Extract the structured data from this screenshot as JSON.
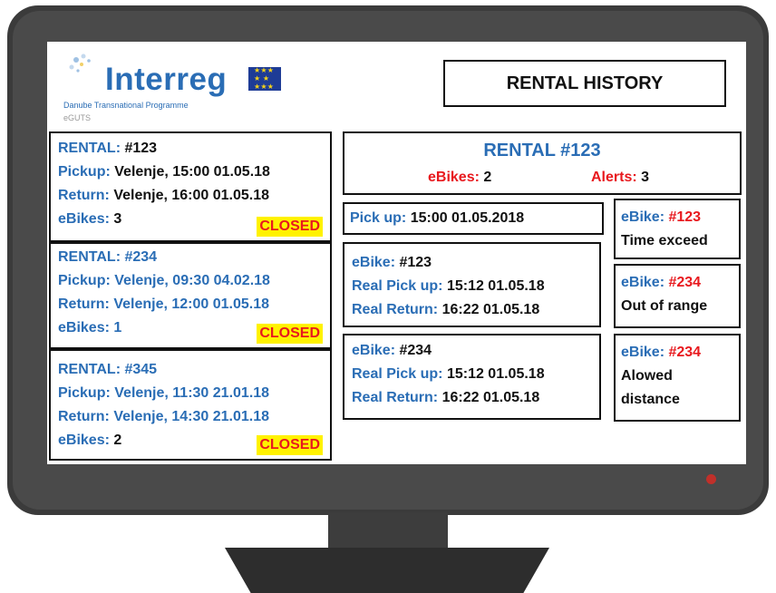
{
  "logo": {
    "brand": "Interreg",
    "program": "Danube Transnational Programme",
    "project": "eGUTS"
  },
  "title": "RENTAL HISTORY",
  "rentals": [
    {
      "rental_label": "RENTAL:",
      "rental_id": "#123",
      "pickup_label": "Pickup:",
      "pickup_value": "Velenje, 15:00  01.05.18",
      "return_label": "Return:",
      "return_value": "Velenje, 16:00  01.05.18",
      "ebikes_label": "eBikes:",
      "ebikes_value": "3",
      "status": "CLOSED"
    },
    {
      "rental_label": "RENTAL:",
      "rental_id": "#234",
      "pickup_label": "Pickup:",
      "pickup_value": "Velenje, 09:30  04.02.18",
      "return_label": "Return:",
      "return_value": "Velenje, 12:00  01.05.18",
      "ebikes_label": "eBikes:",
      "ebikes_value": "1",
      "status": "CLOSED"
    },
    {
      "rental_label": "RENTAL:",
      "rental_id": "#345",
      "pickup_label": "Pickup:",
      "pickup_value": "Velenje, 11:30  21.01.18",
      "return_label": "Return:",
      "return_value": "Velenje, 14:30  21.01.18",
      "ebikes_label": "eBikes:",
      "ebikes_value": "2",
      "status": "CLOSED"
    }
  ],
  "detail": {
    "header": "RENTAL  #123",
    "ebikes_label": "eBikes:",
    "ebikes_value": "2",
    "alerts_label": "Alerts:",
    "alerts_value": "3",
    "pickup_label": "Pick up:",
    "pickup_value": "15:00  01.05.2018",
    "bikes": [
      {
        "label": "eBike:",
        "id": "#123",
        "pickup_label": "Real Pick up:",
        "pickup_value": "15:12  01.05.18",
        "return_label": "Real Return:",
        "return_value": "16:22  01.05.18"
      },
      {
        "label": "eBike:",
        "id": "#234",
        "pickup_label": "Real Pick up:",
        "pickup_value": "15:12  01.05.18",
        "return_label": "Real Return:",
        "return_value": "16:22  01.05.18"
      }
    ],
    "alerts": [
      {
        "label": "eBike:",
        "id": "#123",
        "message": "Time exceed"
      },
      {
        "label": "eBike:",
        "id": "#234",
        "message": "Out of range"
      },
      {
        "label": "eBike:",
        "id": "#234",
        "message": "Alowed distance"
      }
    ]
  },
  "colors": {
    "accent_blue": "#2a6db5",
    "alert_red": "#e8191e",
    "closed_badge": "#fff200",
    "bezel": "#3b3b3b"
  }
}
